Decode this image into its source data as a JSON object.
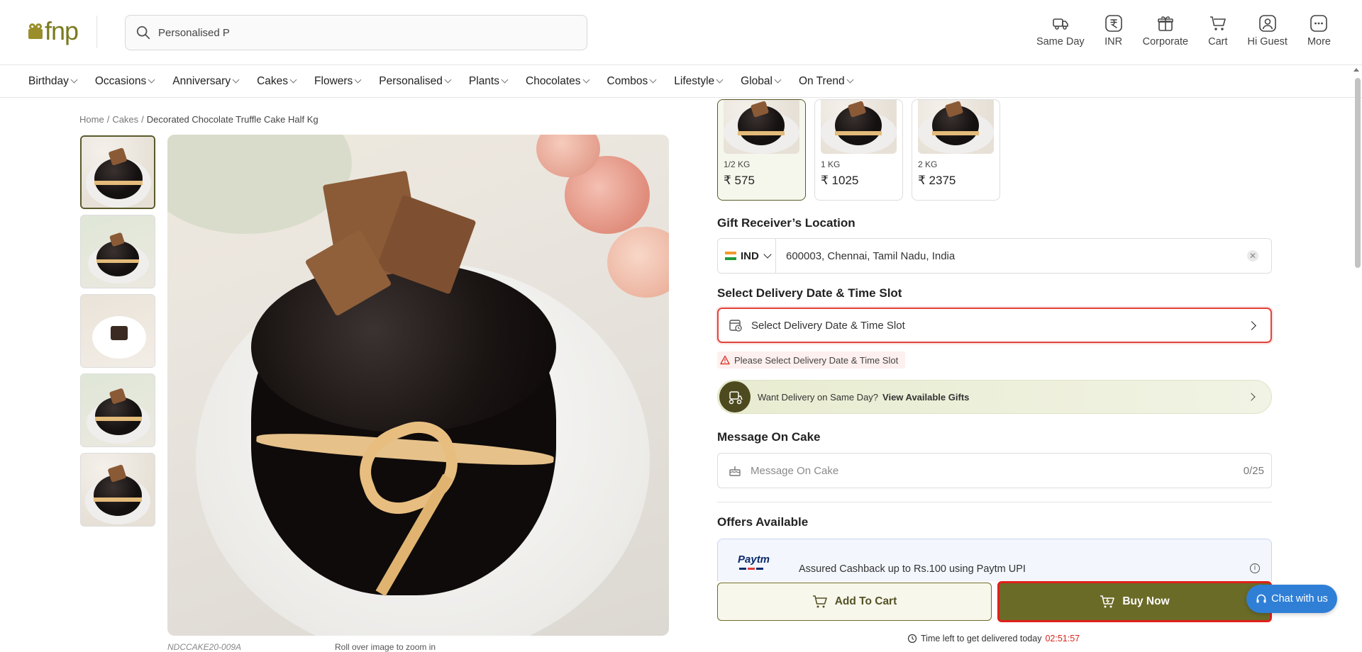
{
  "header": {
    "logo_text": "fnp",
    "search_value": "Personalised P",
    "icons": [
      {
        "label": "Same Day",
        "icon": "truck-icon"
      },
      {
        "label": "INR",
        "icon": "rupee-icon"
      },
      {
        "label": "Corporate",
        "icon": "corporate-gift-icon"
      },
      {
        "label": "Cart",
        "icon": "cart-icon"
      },
      {
        "label": "Hi Guest",
        "icon": "user-icon"
      },
      {
        "label": "More",
        "icon": "more-icon"
      }
    ]
  },
  "nav": [
    "Birthday",
    "Occasions",
    "Anniversary",
    "Cakes",
    "Flowers",
    "Personalised",
    "Plants",
    "Chocolates",
    "Combos",
    "Lifestyle",
    "Global",
    "On Trend"
  ],
  "breadcrumb": {
    "home": "Home",
    "category": "Cakes",
    "current": "Decorated Chocolate Truffle Cake Half Kg"
  },
  "product": {
    "sku": "NDCCAKE20-009A",
    "zoom_hint": "Roll over image to zoom in"
  },
  "weights": [
    {
      "label": "1/2 KG",
      "price": "₹ 575",
      "active": true
    },
    {
      "label": "1 KG",
      "price": "₹ 1025",
      "active": false
    },
    {
      "label": "2 KG",
      "price": "₹ 2375",
      "active": false
    }
  ],
  "location": {
    "title": "Gift Receiver’s Location",
    "country_code": "IND",
    "value": "600003, Chennai, Tamil Nadu, India"
  },
  "delivery": {
    "title": "Select Delivery Date & Time Slot",
    "field_label": "Select Delivery Date & Time Slot",
    "error": "Please Select Delivery Date & Time Slot"
  },
  "same_day": {
    "text": "Want Delivery on Same Day?",
    "link": "View Available Gifts"
  },
  "message": {
    "title": "Message On Cake",
    "placeholder": "Message On Cake",
    "counter": "0/25"
  },
  "offers": {
    "title": "Offers Available",
    "items": [
      {
        "brand": "Paytm",
        "text": "Assured Cashback up to Rs.100 using Paytm UPI"
      }
    ]
  },
  "actions": {
    "add_to_cart": "Add To Cart",
    "buy_now": "Buy Now",
    "timer_text": "Time left to get delivered today",
    "timer_value": "02:51:57"
  },
  "chat": {
    "label": "Chat with us"
  },
  "colors": {
    "brand_olive": "#6b6b28",
    "error_red": "#e0453c",
    "timer_red": "#d9261c",
    "chat_blue": "#2f7fd6"
  }
}
